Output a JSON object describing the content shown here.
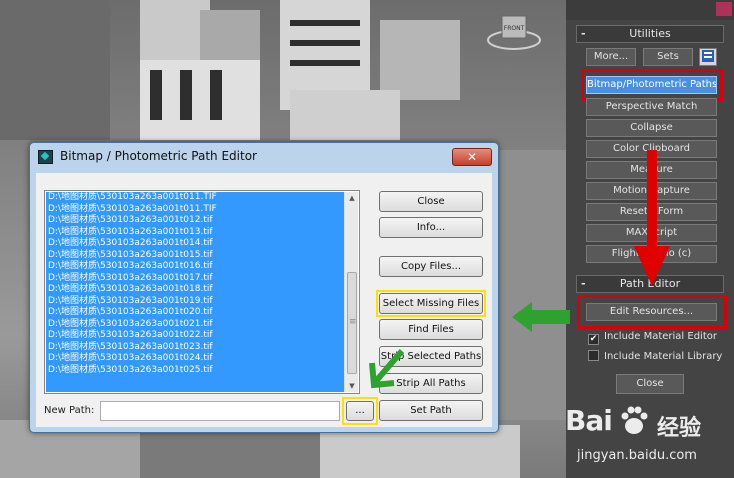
{
  "colors": {
    "accent_red": "#d4000c",
    "highlight_yellow": "#ffe100",
    "arrow_green": "#2fa12f",
    "selection_blue": "#3399ff"
  },
  "viewport": {
    "gizmo_label": "FRONT"
  },
  "dialog": {
    "title": "Bitmap / Photometric Path Editor",
    "files": [
      "D:\\地图材质\\530103a263a001t011.TIF",
      "D:\\地图材质\\530103a263a001t011.TIF",
      "D:\\地图材质\\530103a263a001t012.tif",
      "D:\\地图材质\\530103a263a001t013.tif",
      "D:\\地图材质\\530103a263a001t014.tif",
      "D:\\地图材质\\530103a263a001t015.tif",
      "D:\\地图材质\\530103a263a001t016.tif",
      "D:\\地图材质\\530103a263a001t017.tif",
      "D:\\地图材质\\530103a263a001t018.tif",
      "D:\\地图材质\\530103a263a001t019.tif",
      "D:\\地图材质\\530103a263a001t020.tif",
      "D:\\地图材质\\530103a263a001t021.tif",
      "D:\\地图材质\\530103a263a001t022.tif",
      "D:\\地图材质\\530103a263a001t023.tif",
      "D:\\地图材质\\530103a263a001t024.tif",
      "D:\\地图材质\\530103a263a001t025.tif"
    ],
    "buttons": {
      "close": "Close",
      "info": "Info...",
      "copy_files": "Copy Files...",
      "select_missing": "Select Missing Files",
      "find_files": "Find Files",
      "strip_selected": "Strip Selected Paths",
      "strip_all": "Strip All Paths",
      "set_path": "Set Path",
      "browse": "..."
    },
    "new_path_label": "New Path:",
    "new_path_value": ""
  },
  "panel": {
    "utilities_title": "Utilities",
    "more": "More...",
    "sets": "Sets",
    "items": [
      "Bitmap/Photometric Paths",
      "Perspective Match",
      "Collapse",
      "Color Clipboard",
      "Measure",
      "Motion Capture",
      "Reset XForm",
      "MAXScript",
      "Flight Studio (c)"
    ],
    "path_editor_title": "Path Editor",
    "edit_resources": "Edit Resources...",
    "include_material_editor": "Include Material Editor",
    "include_material_library": "Include Material Library",
    "close": "Close"
  },
  "watermark": {
    "logo": "Bai",
    "cn": "经验",
    "url": "jingyan.baidu.com"
  }
}
